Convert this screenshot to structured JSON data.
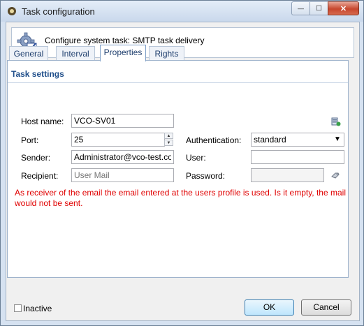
{
  "window": {
    "title": "Task configuration",
    "close_glyph": "✕",
    "min_glyph": "—",
    "max_glyph": "☐"
  },
  "header": {
    "text": "Configure system task: SMTP task delivery",
    "icon": "gear-check-icon"
  },
  "tabs": [
    {
      "label": "General"
    },
    {
      "label": "Interval"
    },
    {
      "label": "Properties",
      "active": true
    },
    {
      "label": "Rights"
    }
  ],
  "section": {
    "title": "Task settings"
  },
  "fields": {
    "host_label": "Host name:",
    "host_value": "VCO-SV01",
    "port_label": "Port:",
    "port_value": "25",
    "sender_label": "Sender:",
    "sender_value": "Administrator@vco-test.com",
    "recipient_label": "Recipient:",
    "recipient_placeholder": "User Mail",
    "auth_label": "Authentication:",
    "auth_value": "standard",
    "user_label": "User:",
    "user_value": "",
    "password_label": "Password:",
    "password_value": ""
  },
  "warning": "As receiver of the email the email entered at the users profile is used. Is it empty, the mail would not be sent.",
  "footer": {
    "inactive_label": "Inactive",
    "inactive_checked": false,
    "ok_label": "OK",
    "cancel_label": "Cancel"
  },
  "colors": {
    "warning": "#e00000",
    "section_title": "#1f4e8a",
    "tab_text": "#1f3f6e"
  }
}
